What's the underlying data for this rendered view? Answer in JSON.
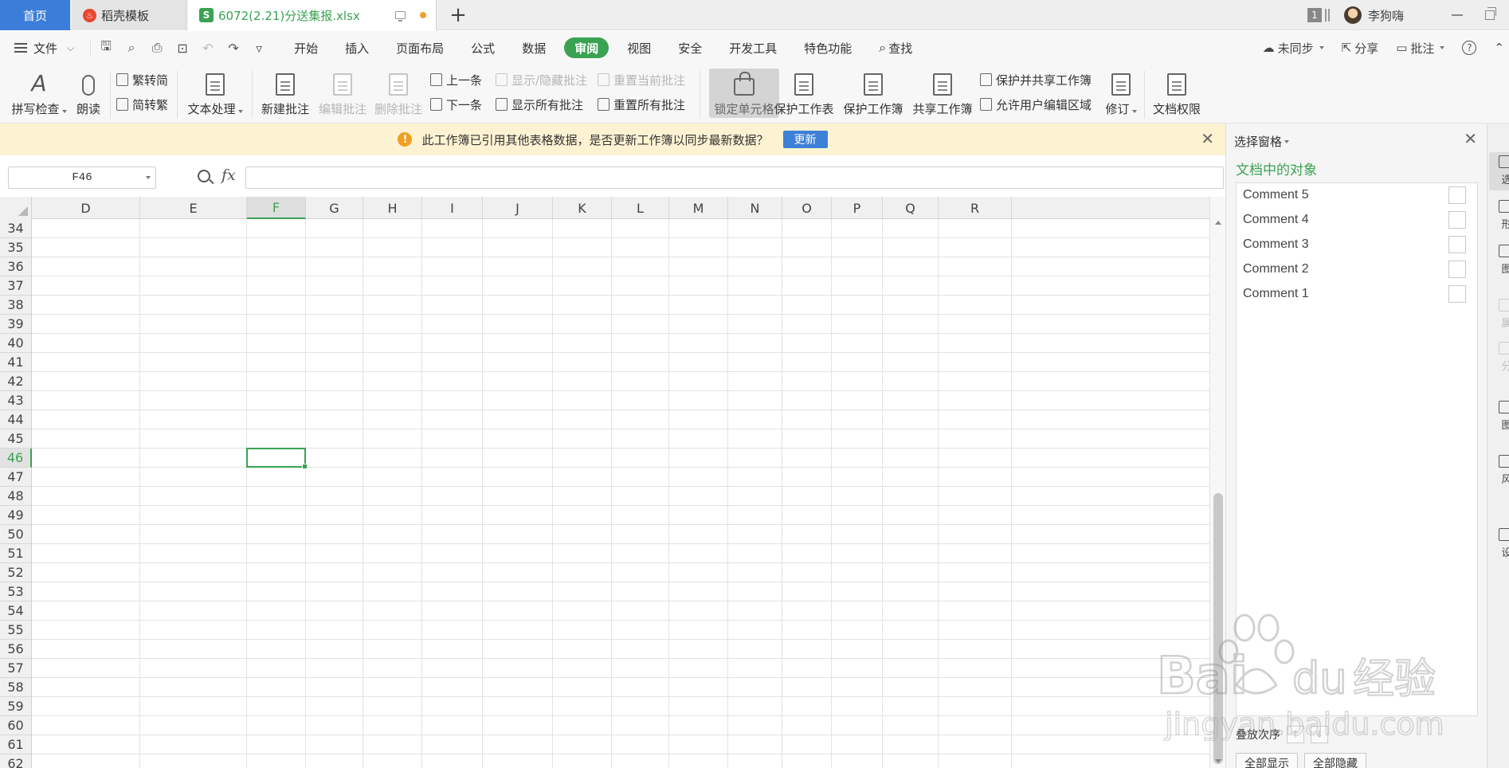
{
  "tabbar": {
    "home": "首页",
    "daoke": "稻壳模板",
    "file": "6072(2.21)分送集报.xlsx",
    "badge": "1",
    "user": "李狗嗨"
  },
  "menubar": {
    "file": "文件",
    "tabs": [
      "开始",
      "插入",
      "页面布局",
      "公式",
      "数据",
      "审阅",
      "视图",
      "安全",
      "开发工具",
      "特色功能",
      "查找"
    ],
    "active_tab": "审阅",
    "right": {
      "sync": "未同步",
      "share": "分享",
      "comment": "批注"
    }
  },
  "ribbon": {
    "spell": "拼写检查",
    "read": "朗读",
    "trad_to_simp": "繁转简",
    "simp_to_trad": "简转繁",
    "text_process": "文本处理",
    "new_comment": "新建批注",
    "edit_comment": "编辑批注",
    "delete_comment": "删除批注",
    "prev": "上一条",
    "next": "下一条",
    "show_hide": "显示/隐藏批注",
    "show_all": "显示所有批注",
    "reset_current": "重置当前批注",
    "reset_all": "重置所有批注",
    "lock_cell": "锁定单元格",
    "protect_sheet": "保护工作表",
    "protect_book": "保护工作簿",
    "share_book": "共享工作簿",
    "protect_share": "保护并共享工作簿",
    "allow_edit": "允许用户编辑区域",
    "revise": "修订",
    "doc_rights": "文档权限"
  },
  "notification": {
    "text": "此工作簿已引用其他表格数据，是否更新工作簿以同步最新数据？",
    "button": "更新"
  },
  "formula_bar": {
    "cell_ref": "F46",
    "fx": "fx",
    "value": ""
  },
  "grid": {
    "columns": [
      "D",
      "E",
      "F",
      "G",
      "H",
      "I",
      "J",
      "K",
      "L",
      "M",
      "N",
      "O",
      "P",
      "Q",
      "R"
    ],
    "rows": [
      "34",
      "35",
      "36",
      "37",
      "38",
      "39",
      "40",
      "41",
      "42",
      "43",
      "44",
      "45",
      "46",
      "47",
      "48",
      "49",
      "50",
      "51",
      "52",
      "53",
      "54",
      "55",
      "56",
      "57",
      "58",
      "59",
      "60",
      "61",
      "62"
    ],
    "selected_col": "F",
    "selected_row": "46"
  },
  "pane": {
    "title": "选择窗格",
    "subtitle": "文档中的对象",
    "items": [
      "Comment 5",
      "Comment 4",
      "Comment 3",
      "Comment 2",
      "Comment 1"
    ],
    "order_label": "叠放次序",
    "show_all": "全部显示",
    "hide_all": "全部隐藏"
  },
  "strip": [
    "选",
    "形",
    "图",
    "属",
    "分",
    "图",
    "风",
    "设"
  ],
  "watermark": {
    "brand": "Bai",
    "brand2": "du",
    "cn": "经验",
    "url": "jingyan.baidu.com"
  }
}
